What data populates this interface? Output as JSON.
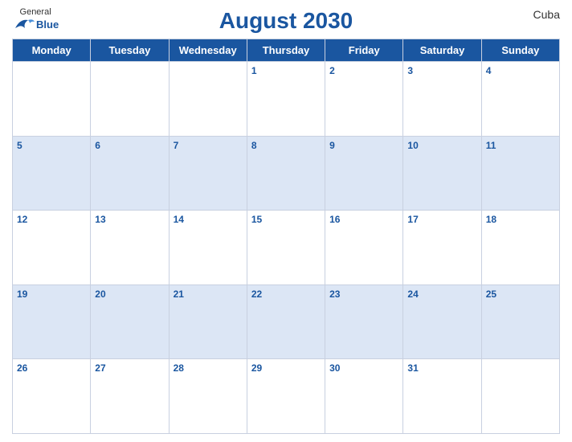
{
  "header": {
    "logo_general": "General",
    "logo_blue": "Blue",
    "title": "August 2030",
    "country": "Cuba"
  },
  "days_of_week": [
    "Monday",
    "Tuesday",
    "Wednesday",
    "Thursday",
    "Friday",
    "Saturday",
    "Sunday"
  ],
  "weeks": [
    [
      {
        "day": "",
        "dark": false
      },
      {
        "day": "",
        "dark": false
      },
      {
        "day": "",
        "dark": false
      },
      {
        "day": "1",
        "dark": false
      },
      {
        "day": "2",
        "dark": false
      },
      {
        "day": "3",
        "dark": false
      },
      {
        "day": "4",
        "dark": false
      }
    ],
    [
      {
        "day": "5",
        "dark": true
      },
      {
        "day": "6",
        "dark": true
      },
      {
        "day": "7",
        "dark": true
      },
      {
        "day": "8",
        "dark": true
      },
      {
        "day": "9",
        "dark": true
      },
      {
        "day": "10",
        "dark": true
      },
      {
        "day": "11",
        "dark": true
      }
    ],
    [
      {
        "day": "12",
        "dark": false
      },
      {
        "day": "13",
        "dark": false
      },
      {
        "day": "14",
        "dark": false
      },
      {
        "day": "15",
        "dark": false
      },
      {
        "day": "16",
        "dark": false
      },
      {
        "day": "17",
        "dark": false
      },
      {
        "day": "18",
        "dark": false
      }
    ],
    [
      {
        "day": "19",
        "dark": true
      },
      {
        "day": "20",
        "dark": true
      },
      {
        "day": "21",
        "dark": true
      },
      {
        "day": "22",
        "dark": true
      },
      {
        "day": "23",
        "dark": true
      },
      {
        "day": "24",
        "dark": true
      },
      {
        "day": "25",
        "dark": true
      }
    ],
    [
      {
        "day": "26",
        "dark": false
      },
      {
        "day": "27",
        "dark": false
      },
      {
        "day": "28",
        "dark": false
      },
      {
        "day": "29",
        "dark": false
      },
      {
        "day": "30",
        "dark": false
      },
      {
        "day": "31",
        "dark": false
      },
      {
        "day": "",
        "dark": false
      }
    ]
  ]
}
